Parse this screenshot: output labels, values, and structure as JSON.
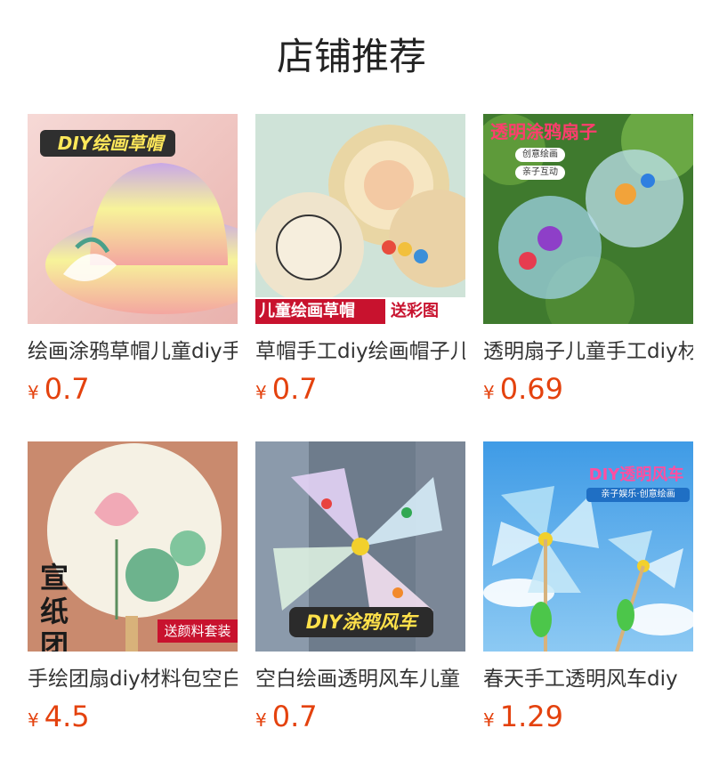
{
  "page": {
    "title": "店铺推荐"
  },
  "products": [
    {
      "name": "绘画涂鸦草帽儿童diy手工",
      "currency": "¥",
      "price": "0.7",
      "image_text": [
        "DIY绘画草帽"
      ],
      "image_subject": "painted-straw-hat"
    },
    {
      "name": "草帽手工diy绘画帽子儿童",
      "currency": "¥",
      "price": "0.7",
      "image_text": [
        "儿童绘画草帽",
        "送彩图"
      ],
      "image_subject": "straw-hats-with-paints"
    },
    {
      "name": "透明扇子儿童手工diy材料",
      "currency": "¥",
      "price": "0.69",
      "image_text": [
        "透明涂鸦扇子",
        "创意绘画",
        "亲子互动"
      ],
      "image_subject": "transparent-painted-fans"
    },
    {
      "name": "手绘团扇diy材料包空白",
      "currency": "¥",
      "price": "4.5",
      "image_text": [
        "宣纸团扇",
        "送颜料套装"
      ],
      "image_subject": "lotus-round-fan"
    },
    {
      "name": "空白绘画透明风车儿童",
      "currency": "¥",
      "price": "0.7",
      "image_text": [
        "DIY涂鸦风车"
      ],
      "image_subject": "painted-pinwheels"
    },
    {
      "name": "春天手工透明风车diy",
      "currency": "¥",
      "price": "1.29",
      "image_text": [
        "DIY透明风车",
        "亲子娱乐·创意绘画"
      ],
      "image_subject": "pinwheels-blue-sky"
    }
  ]
}
